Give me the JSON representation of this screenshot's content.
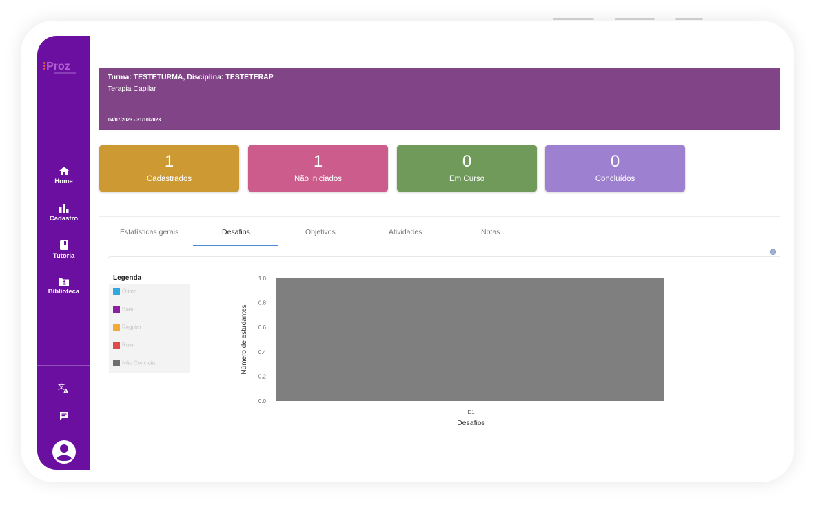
{
  "sidebar": {
    "logo": "Proz",
    "items": [
      {
        "label": "Home",
        "icon": "home-icon"
      },
      {
        "label": "Cadastro",
        "icon": "bar-chart-icon"
      },
      {
        "label": "Tutoria",
        "icon": "book-icon"
      },
      {
        "label": "Biblioteca",
        "icon": "folder-account-icon"
      }
    ],
    "bottom_icons": [
      "translate-icon",
      "chat-icon",
      "account-circle-icon"
    ]
  },
  "header": {
    "title": "Turma: TESTETURMA, Disciplina: TESTETERAP",
    "subtitle": "Terapia Capilar",
    "dates": "04/07/2023 - 31/10/2023"
  },
  "stats": [
    {
      "value": "1",
      "label": "Cadastrados",
      "color": "#cc9933"
    },
    {
      "value": "1",
      "label": "Não iniciados",
      "color": "#cc5c8c"
    },
    {
      "value": "0",
      "label": "Em Curso",
      "color": "#6f9a5a"
    },
    {
      "value": "0",
      "label": "Concluídos",
      "color": "#9d80d0"
    }
  ],
  "tabs": [
    {
      "label": "Estatísticas gerais",
      "active": false
    },
    {
      "label": "Desafios",
      "active": true
    },
    {
      "label": "Objetivos",
      "active": false
    },
    {
      "label": "Atividades",
      "active": false
    },
    {
      "label": "Notas",
      "active": false
    }
  ],
  "legend": {
    "title": "Legenda",
    "items": [
      {
        "label": "Ótimo",
        "color": "#2fa8e0"
      },
      {
        "label": "Bom",
        "color": "#8b1fa3"
      },
      {
        "label": "Regular",
        "color": "#f3a93a"
      },
      {
        "label": "Ruim",
        "color": "#e04a4a"
      },
      {
        "label": "Não Concluiu",
        "color": "#6f6f6f"
      }
    ]
  },
  "chart_data": {
    "type": "bar",
    "categories": [
      "D1"
    ],
    "series": [
      {
        "name": "Não Concluiu",
        "values": [
          1.0
        ],
        "color": "#7f7f7f"
      }
    ],
    "xlabel": "Desafios",
    "ylabel": "Número de estudantes",
    "ylim": [
      0,
      1.0
    ],
    "yticks": [
      "0.0",
      "0.2",
      "0.4",
      "0.6",
      "0.8",
      "1.0"
    ],
    "grid": false
  }
}
